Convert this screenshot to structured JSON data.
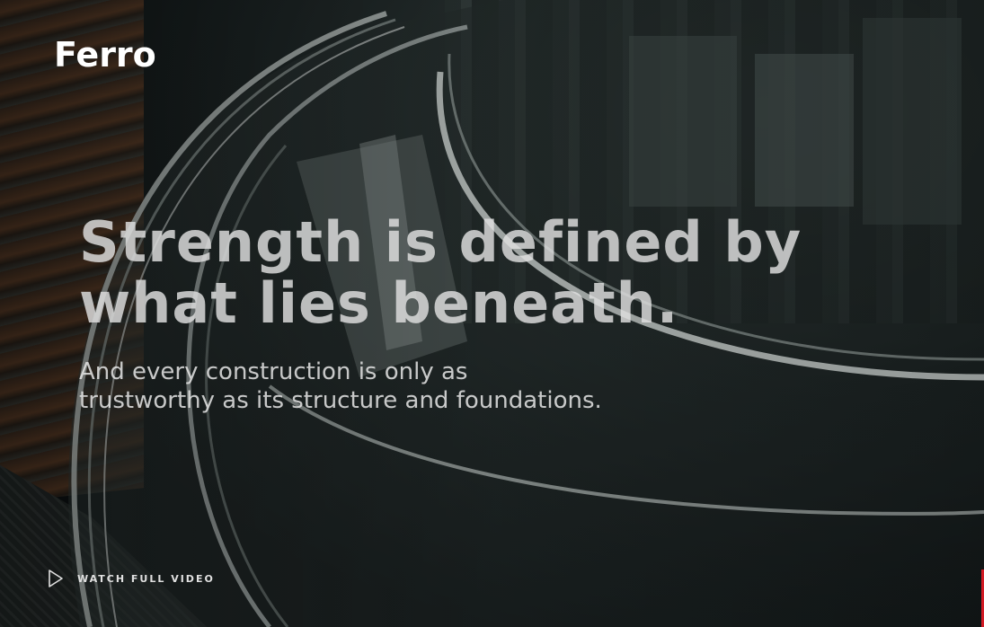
{
  "brand": {
    "logo_text": "Ferro"
  },
  "hero": {
    "headline_line1": "Strength is defined by",
    "headline_line2": "what lies beneath.",
    "subhead_line1": "And every construction is only as",
    "subhead_line2": "trustworthy as its structure and foundations."
  },
  "video_link": {
    "label": "WATCH FULL VIDEO",
    "icon": "play-icon"
  },
  "colors": {
    "text": "#ffffff",
    "accent": "#d21a24",
    "background": "#0d1112"
  }
}
